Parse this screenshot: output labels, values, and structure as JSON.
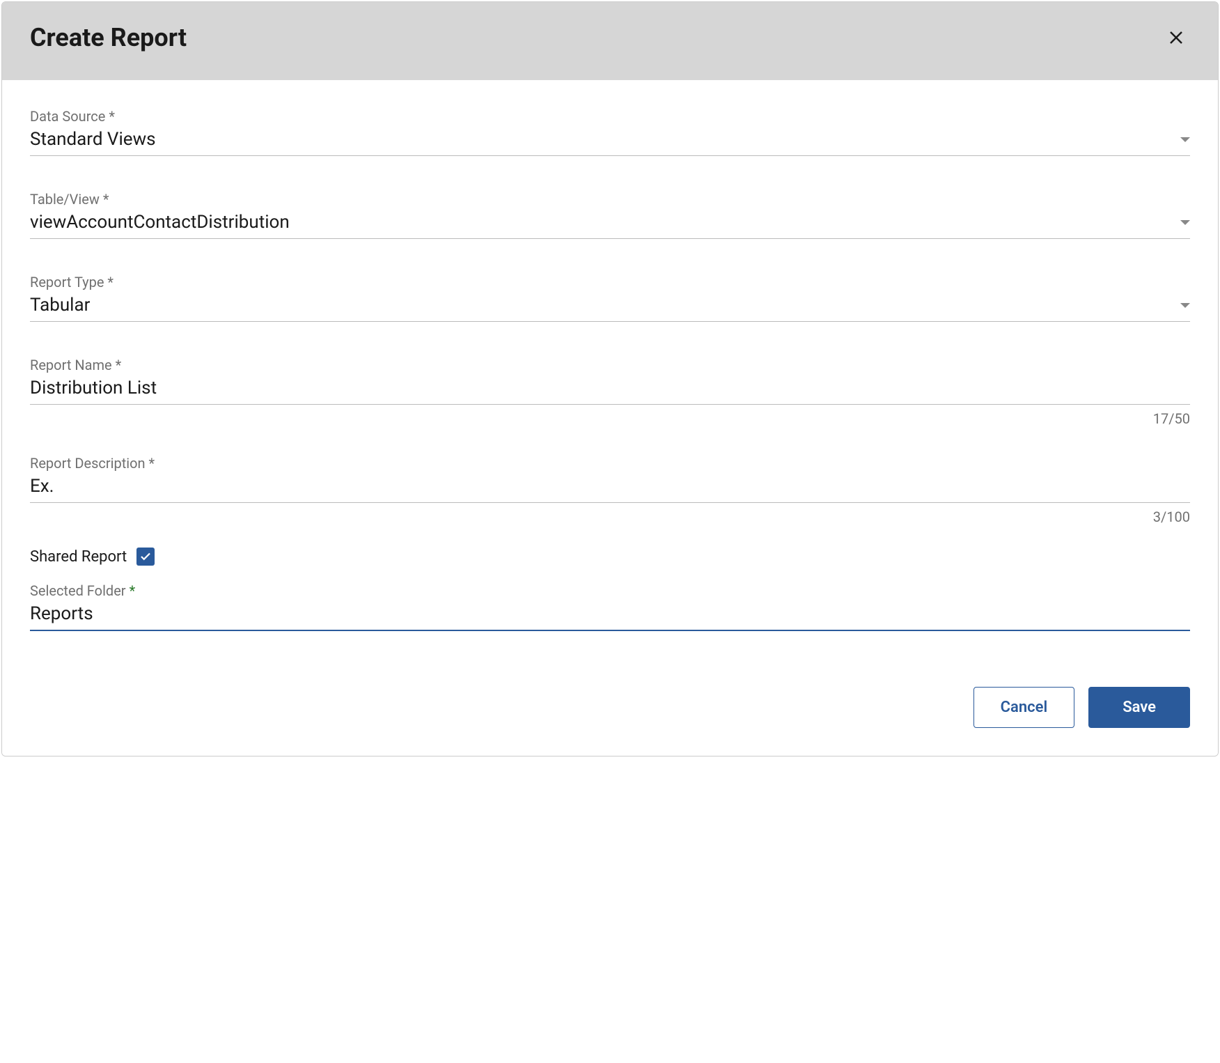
{
  "dialog": {
    "title": "Create Report"
  },
  "fields": {
    "dataSource": {
      "label": "Data Source *",
      "value": "Standard Views"
    },
    "tableView": {
      "label": "Table/View *",
      "value": "viewAccountContactDistribution"
    },
    "reportType": {
      "label": "Report Type *",
      "value": "Tabular"
    },
    "reportName": {
      "label": "Report Name *",
      "value": "Distribution List",
      "counter": "17/50"
    },
    "reportDescription": {
      "label": "Report Description *",
      "value": "Ex.",
      "counter": "3/100"
    },
    "sharedReport": {
      "label": "Shared Report",
      "checked": true
    },
    "selectedFolder": {
      "label": "Selected Folder ",
      "required": "*",
      "value": "Reports"
    }
  },
  "buttons": {
    "cancel": "Cancel",
    "save": "Save"
  }
}
